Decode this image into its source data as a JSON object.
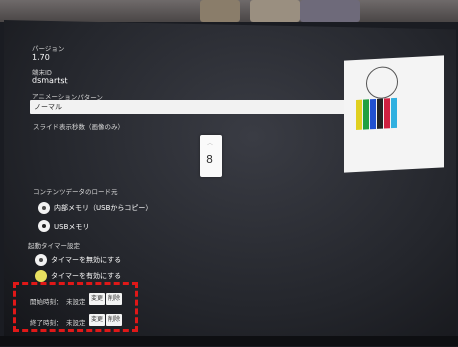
{
  "settings": {
    "version_label": "バージョン",
    "version_value": "1.70",
    "model_label": "端末ID",
    "model_value": "dsmartst",
    "animation_label": "アニメーションパターン",
    "animation_value": "ノーマル",
    "slide_label": "スライド表示秒数（画像のみ）",
    "slide_value": "8",
    "content_label": "コンテンツデータのロード元",
    "content_options": [
      "内部メモリ（USBからコピー）",
      "USBメモリ"
    ],
    "timer_label": "起動タイマー設定",
    "timer_options": [
      "タイマーを無効にする",
      "タイマーを有効にする"
    ],
    "start_label": "開始時刻：",
    "start_value": "未設定",
    "end_label": "終了時刻：",
    "end_value": "未設定",
    "set_button": "変更",
    "delete_button": "削除"
  },
  "colors": {
    "highlight": "#e01818",
    "radio_selected": "#e8e060"
  }
}
